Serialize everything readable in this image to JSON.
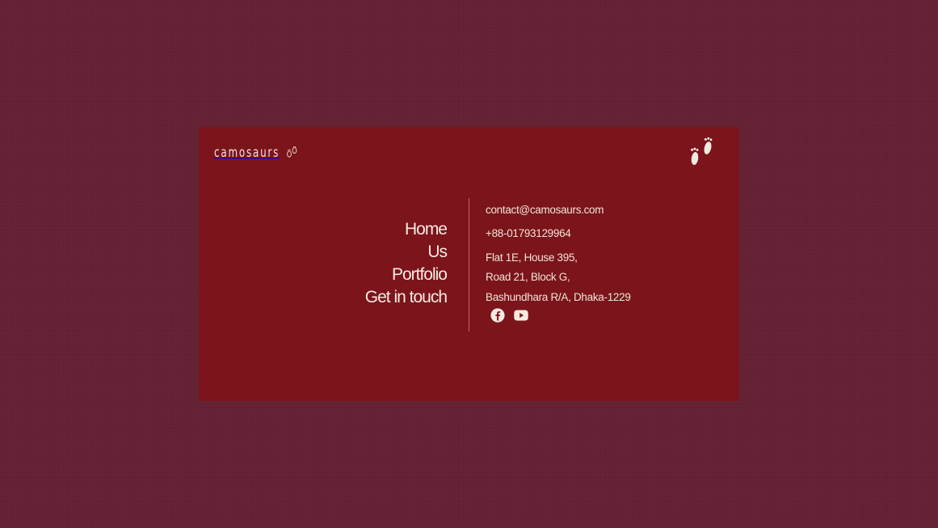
{
  "brand": {
    "logo_text": "camosaurs",
    "logo_icon": "footprints-icon",
    "corner_icon": "footprints-icon"
  },
  "nav": {
    "items": [
      {
        "label": "Home"
      },
      {
        "label": "Us"
      },
      {
        "label": "Portfolio"
      },
      {
        "label": "Get in touch"
      }
    ]
  },
  "contact": {
    "email": "contact@camosaurs.com",
    "phone": "+88-01793129964",
    "address_line1": "Flat 1E, House 395,",
    "address_line2": "Road 21, Block G,",
    "address_line3": "Bashundhara R/A, Dhaka-1229"
  },
  "social": [
    {
      "name": "facebook",
      "icon": "facebook-icon"
    },
    {
      "name": "youtube",
      "icon": "youtube-icon"
    }
  ],
  "colors": {
    "page_background": "#632033",
    "card_background": "#7c141c",
    "text": "#efe4d4"
  }
}
